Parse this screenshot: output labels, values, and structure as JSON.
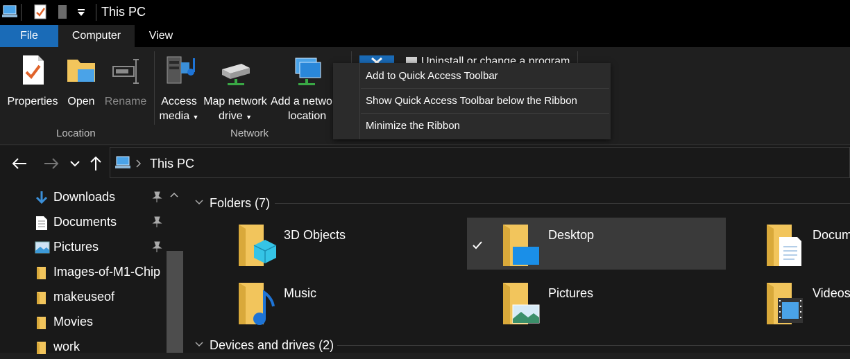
{
  "window": {
    "title": "This PC"
  },
  "tabs": [
    {
      "label": "File"
    },
    {
      "label": "Computer"
    },
    {
      "label": "View"
    }
  ],
  "ribbon": {
    "location_group": {
      "label": "Location",
      "buttons": [
        {
          "label": "Properties"
        },
        {
          "label": "Open"
        },
        {
          "label": "Rename"
        }
      ]
    },
    "network_group": {
      "label": "Network",
      "access_media": {
        "line1": "Access",
        "line2": "media"
      },
      "map_network_drive": {
        "line1": "Map network",
        "line2": "drive"
      },
      "add_network_location": {
        "line1": "Add a netwo",
        "line2": "location"
      }
    },
    "system_group": {
      "uninstall_label": "Uninstall or change a program"
    }
  },
  "context_menu": {
    "items": [
      {
        "label": "Add to Quick Access Toolbar"
      },
      {
        "label": "Show Quick Access Toolbar below the Ribbon"
      },
      {
        "label": "Minimize the Ribbon"
      }
    ]
  },
  "address_bar": {
    "location": "This PC"
  },
  "sidebar": {
    "items": [
      {
        "label": "Downloads",
        "pinned": true
      },
      {
        "label": "Documents",
        "pinned": true
      },
      {
        "label": "Pictures",
        "pinned": true
      },
      {
        "label": "Images-of-M1-Chip",
        "pinned": false
      },
      {
        "label": "makeuseof",
        "pinned": false
      },
      {
        "label": "Movies",
        "pinned": false
      },
      {
        "label": "work",
        "pinned": false
      }
    ]
  },
  "content": {
    "folders_header": "Folders (7)",
    "devices_header": "Devices and drives (2)",
    "folders": [
      {
        "name": "3D Objects"
      },
      {
        "name": "Desktop",
        "selected": true
      },
      {
        "name": "Docum"
      },
      {
        "name": "Music"
      },
      {
        "name": "Pictures"
      },
      {
        "name": "Videos"
      }
    ]
  },
  "colors": {
    "accent": "#1a6bb7",
    "folder": "#f2c55c",
    "background": "#191919"
  }
}
